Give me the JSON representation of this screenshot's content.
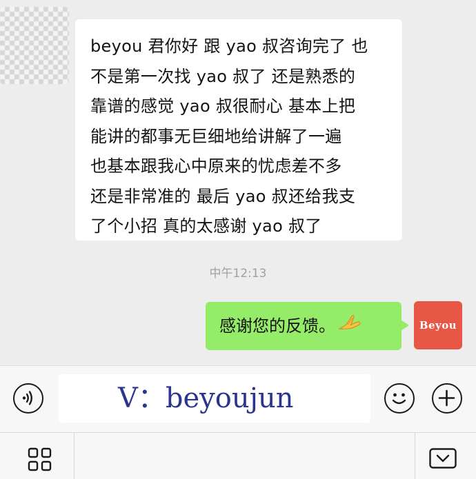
{
  "conversation": {
    "incoming_message": {
      "lines": [
        "beyou 君你好 跟 yao 叔咨询完了 也",
        "不是第一次找 yao 叔了 还是熟悉的",
        "靠谱的感觉 yao 叔很耐心 基本上把",
        "能讲的都事无巨细地给讲解了一遍",
        "也基本跟我心中原来的忧虑差不多",
        "还是非常准的 最后 yao 叔还给我支",
        "了个小招 真的太感谢 yao 叔了"
      ]
    },
    "timestamp": "中午12:13",
    "outgoing_message": {
      "text": "感谢您的反馈。",
      "emoji": "pray-hands-emoji"
    },
    "my_avatar_text": "Beyou"
  },
  "input_bar": {
    "input_value": "V：beyoujun",
    "voice_icon": "voice-icon",
    "emoji_icon": "smiley-icon",
    "plus_icon": "plus-icon"
  },
  "menu_bar": {
    "menu_icon": "grid-icon",
    "keyboard_icon": "keyboard-chevron-icon"
  },
  "colors": {
    "background": "#ededed",
    "outgoing_bubble": "#95ec69",
    "incoming_bubble": "#ffffff",
    "avatar_red": "#e85646",
    "watermark_text": "#2b3590"
  }
}
